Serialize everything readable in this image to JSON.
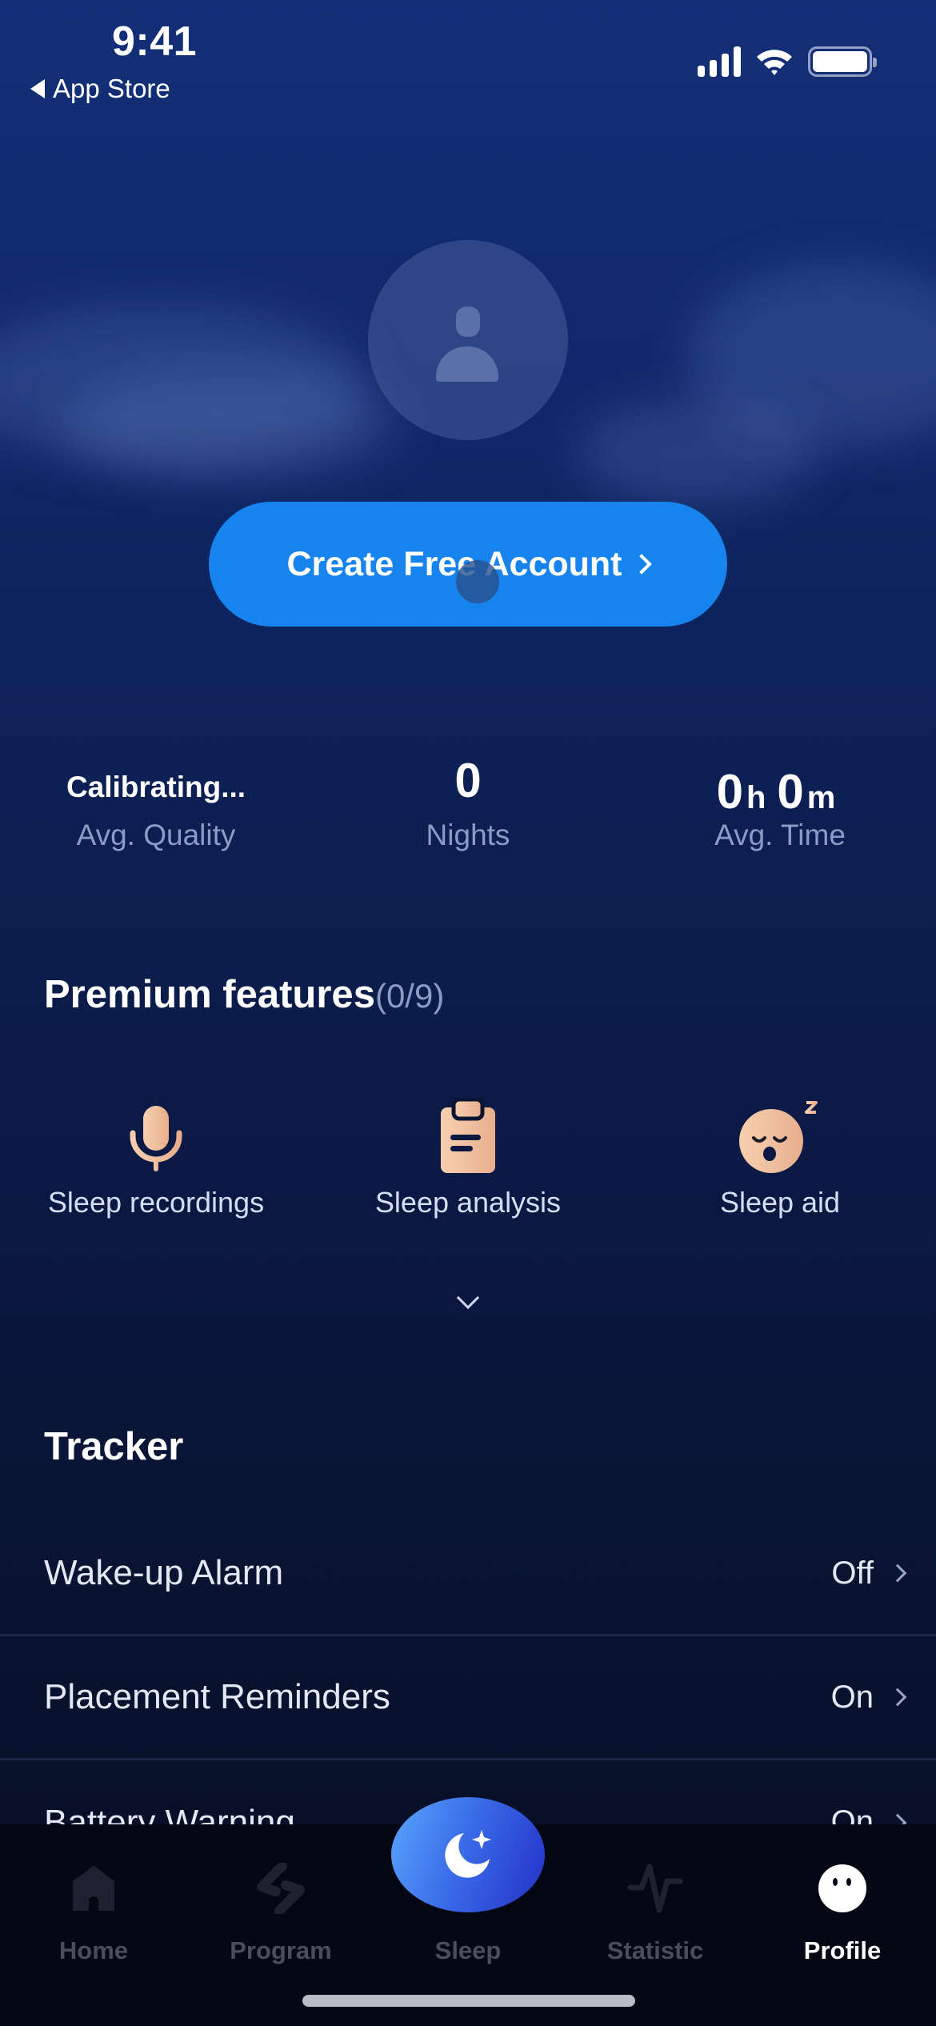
{
  "status_bar": {
    "time": "9:41",
    "back_label": "App Store"
  },
  "profile": {
    "avatar_icon": "person-icon",
    "cta_label": "Create Free Account",
    "cta_color": "#1684ec"
  },
  "stats": [
    {
      "value": "Calibrating...",
      "label": "Avg. Quality"
    },
    {
      "value": "0",
      "label": "Nights"
    },
    {
      "value_hours": "0",
      "hours_unit": "h",
      "value_minutes": "0",
      "minutes_unit": "m",
      "label": "Avg. Time"
    }
  ],
  "premium": {
    "title": "Premium features",
    "count": "(0/9)",
    "features": [
      {
        "label": "Sleep recordings",
        "icon": "microphone-icon"
      },
      {
        "label": "Sleep analysis",
        "icon": "clipboard-icon"
      },
      {
        "label": "Sleep aid",
        "icon": "sleeping-face-icon"
      }
    ],
    "accent_color": "#f2c4a0"
  },
  "tracker": {
    "title": "Tracker",
    "rows": [
      {
        "label": "Wake-up Alarm",
        "value": "Off"
      },
      {
        "label": "Placement Reminders",
        "value": "On"
      },
      {
        "label": "Battery Warning",
        "value": "On"
      }
    ]
  },
  "tabbar": {
    "tabs": [
      {
        "label": "Home",
        "icon": "home-icon",
        "active": false
      },
      {
        "label": "Program",
        "icon": "program-icon",
        "active": false
      },
      {
        "label": "Sleep",
        "icon": "moon-icon",
        "active": false
      },
      {
        "label": "Statistic",
        "icon": "pulse-icon",
        "active": false
      },
      {
        "label": "Profile",
        "icon": "profile-face-icon",
        "active": true
      }
    ]
  }
}
